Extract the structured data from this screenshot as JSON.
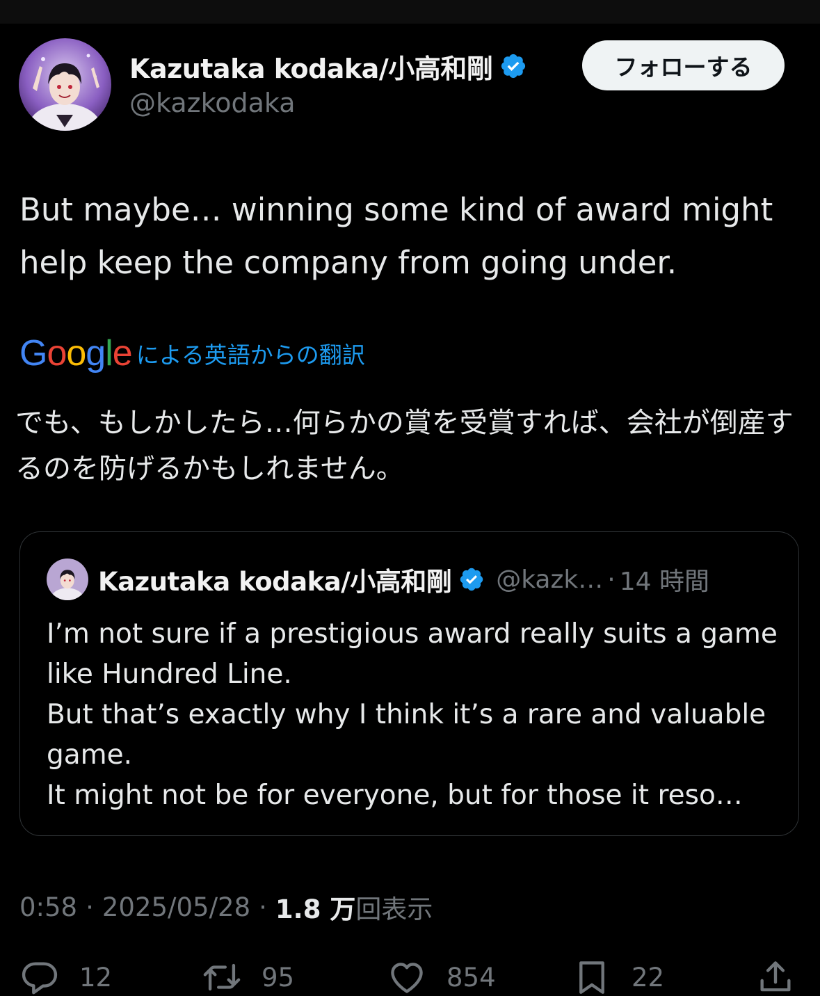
{
  "author": {
    "display_name": "Kazutaka kodaka/小高和剛",
    "handle": "@kazkodaka",
    "verified": true
  },
  "follow_button": {
    "label": "フォローする"
  },
  "tweet": {
    "text": "But maybe… winning some kind of award might help keep the company from going under."
  },
  "translation": {
    "provider": "Google",
    "label": "による英語からの翻訳",
    "text": "でも、もしかしたら…何らかの賞を受賞すれば、会社が倒産するのを防げるかもしれません。"
  },
  "quote": {
    "display_name": "Kazutaka kodaka/小高和剛",
    "handle": "@kazk…",
    "dot": "·",
    "time": "14 時間",
    "verified": true,
    "body": "I’m not sure if a prestigious award really suits a game like Hundred Line.\nBut that’s exactly why I think it’s a rare and valuable game.\nIt might not be for everyone, but for those it reso…"
  },
  "meta": {
    "time": "0:58",
    "sep": "·",
    "date": "2025/05/28",
    "views_count": "1.8 万",
    "views_label": "回表示"
  },
  "actions": {
    "reply_count": "12",
    "repost_count": "95",
    "like_count": "854",
    "bookmark_count": "22"
  },
  "colors": {
    "background": "#000000",
    "text_primary": "#e7e9ea",
    "text_secondary": "#71767b",
    "accent_blue": "#1d9bf0",
    "verified_blue": "#1d9bf0",
    "border": "#2f3336",
    "follow_button_bg": "#eff3f4"
  },
  "icons": {
    "reply": "speech-bubble-icon",
    "repost": "repost-arrows-icon",
    "like": "heart-icon",
    "bookmark": "bookmark-icon",
    "share": "share-upload-icon",
    "verified": "verified-badge-icon"
  }
}
